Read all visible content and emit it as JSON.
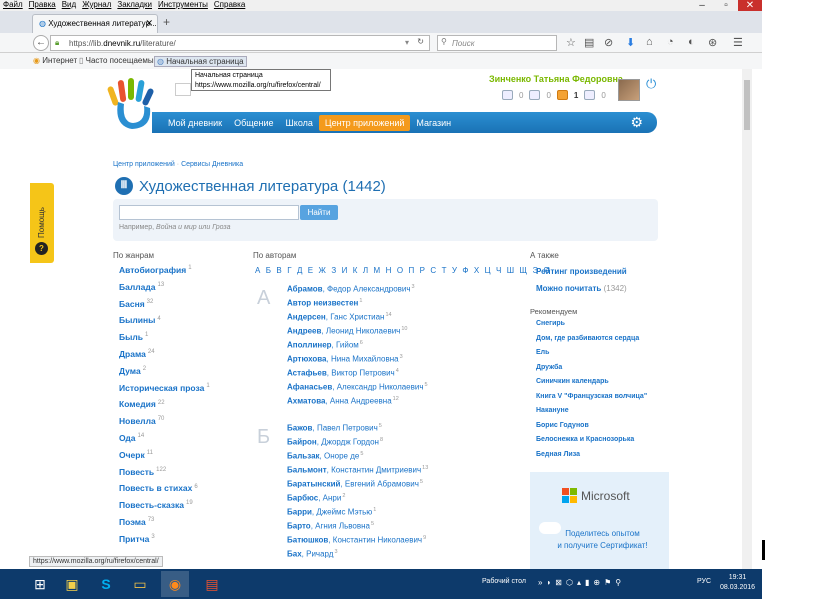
{
  "browser": {
    "menu": [
      "Файл",
      "Правка",
      "Вид",
      "Журнал",
      "Закладки",
      "Инструменты",
      "Справка"
    ],
    "tab_title": "Художественная литератур...",
    "url_prefix": "https://lib.",
    "url_domain": "dnevnik.ru",
    "url_path": "/literature/",
    "search_placeholder": "Поиск",
    "bookmarks": [
      "Интернет",
      "Часто посещаемые",
      "Начальная страница"
    ],
    "tooltip_title": "Начальная страница",
    "tooltip_url": "https://www.mozilla.org/ru/firefox/central/",
    "status_url": "https://www.mozilla.org/ru/firefox/central/"
  },
  "site": {
    "user_name": "Зинченко Татьяна Федоровна",
    "counters": [
      "0",
      "0",
      "1",
      "0"
    ],
    "nav": [
      "Мой дневник",
      "Общение",
      "Школа",
      "Центр приложений",
      "Магазин"
    ],
    "breadcrumb": [
      "Центр приложений",
      "Сервисы Дневника"
    ],
    "title": "Художественная литература (1442)",
    "search_button": "Найти",
    "search_hint_prefix": "Например, ",
    "search_hint_example": "Война и мир или Гроза",
    "help_label": "Помощь"
  },
  "genres": {
    "heading": "По жанрам",
    "items": [
      {
        "name": "Автобиография",
        "count": "1"
      },
      {
        "name": "Баллада",
        "count": "13"
      },
      {
        "name": "Басня",
        "count": "32"
      },
      {
        "name": "Былины",
        "count": "4"
      },
      {
        "name": "Быль",
        "count": "1"
      },
      {
        "name": "Драма",
        "count": "24"
      },
      {
        "name": "Дума",
        "count": "2"
      },
      {
        "name": "Историческая проза",
        "count": "1"
      },
      {
        "name": "Комедия",
        "count": "22"
      },
      {
        "name": "Новелла",
        "count": "70"
      },
      {
        "name": "Ода",
        "count": "14"
      },
      {
        "name": "Очерк",
        "count": "11"
      },
      {
        "name": "Повесть",
        "count": "122"
      },
      {
        "name": "Повесть в стихах",
        "count": "6"
      },
      {
        "name": "Повесть-сказка",
        "count": "19"
      },
      {
        "name": "Поэма",
        "count": "73"
      },
      {
        "name": "Притча",
        "count": "3"
      }
    ]
  },
  "authors": {
    "heading": "По авторам",
    "alphabet": "А Б В Г Д Е Ж З И К Л М Н О П Р С Т У Ф Х Ц Ч Ш Щ Э Я",
    "letter_a": "А",
    "letter_b": "Б",
    "group_a": [
      {
        "last": "Абрамов",
        "first": "Федор Александрович",
        "count": "3"
      },
      {
        "last": "Автор неизвестен",
        "first": "",
        "count": "1"
      },
      {
        "last": "Андерсен",
        "first": "Ганс Христиан",
        "count": "14"
      },
      {
        "last": "Андреев",
        "first": "Леонид Николаевич",
        "count": "10"
      },
      {
        "last": "Аполлинер",
        "first": "Гийом",
        "count": "6"
      },
      {
        "last": "Артюхова",
        "first": "Нина Михайловна",
        "count": "3"
      },
      {
        "last": "Астафьев",
        "first": "Виктор Петрович",
        "count": "4"
      },
      {
        "last": "Афанасьев",
        "first": "Александр Николаевич",
        "count": "5"
      },
      {
        "last": "Ахматова",
        "first": "Анна Андреевна",
        "count": "12"
      }
    ],
    "group_b": [
      {
        "last": "Бажов",
        "first": "Павел Петрович",
        "count": "5"
      },
      {
        "last": "Байрон",
        "first": "Джордж Гордон",
        "count": "8"
      },
      {
        "last": "Бальзак",
        "first": "Оноре де",
        "count": "5"
      },
      {
        "last": "Бальмонт",
        "first": "Константин Дмитриевич",
        "count": "13"
      },
      {
        "last": "Баратынский",
        "first": "Евгений Абрамович",
        "count": "5"
      },
      {
        "last": "Барбюс",
        "first": "Анри",
        "count": "2"
      },
      {
        "last": "Барри",
        "first": "Джеймс Мэтью",
        "count": "1"
      },
      {
        "last": "Барто",
        "first": "Агния Львовна",
        "count": "5"
      },
      {
        "last": "Батюшков",
        "first": "Константин Николаевич",
        "count": "9"
      },
      {
        "last": "Бах",
        "first": "Ричард",
        "count": "3"
      }
    ]
  },
  "also": {
    "heading": "А также",
    "rating": "Рейтинг произведений",
    "read": "Можно почитать",
    "read_count": "(1342)",
    "recommend_heading": "Рекомендуем",
    "recommend": [
      "Снегирь",
      "Дом, где разбиваются сердца",
      "Ель",
      "Дружба",
      "Синичкин календарь",
      "Книга V \"Французская волчица\"",
      "Наканунe",
      "Борис Годунов",
      "Белоснежка и Краснозорька",
      "Бедная Лиза"
    ]
  },
  "ad": {
    "brand": "Microsoft",
    "line1": "Поделитесь опытом",
    "line2": "и получите Сертификат!"
  },
  "taskbar": {
    "desktop_label": "Рабочий стол",
    "lang": "РУС",
    "time": "19:31",
    "date": "08.03.2016"
  }
}
